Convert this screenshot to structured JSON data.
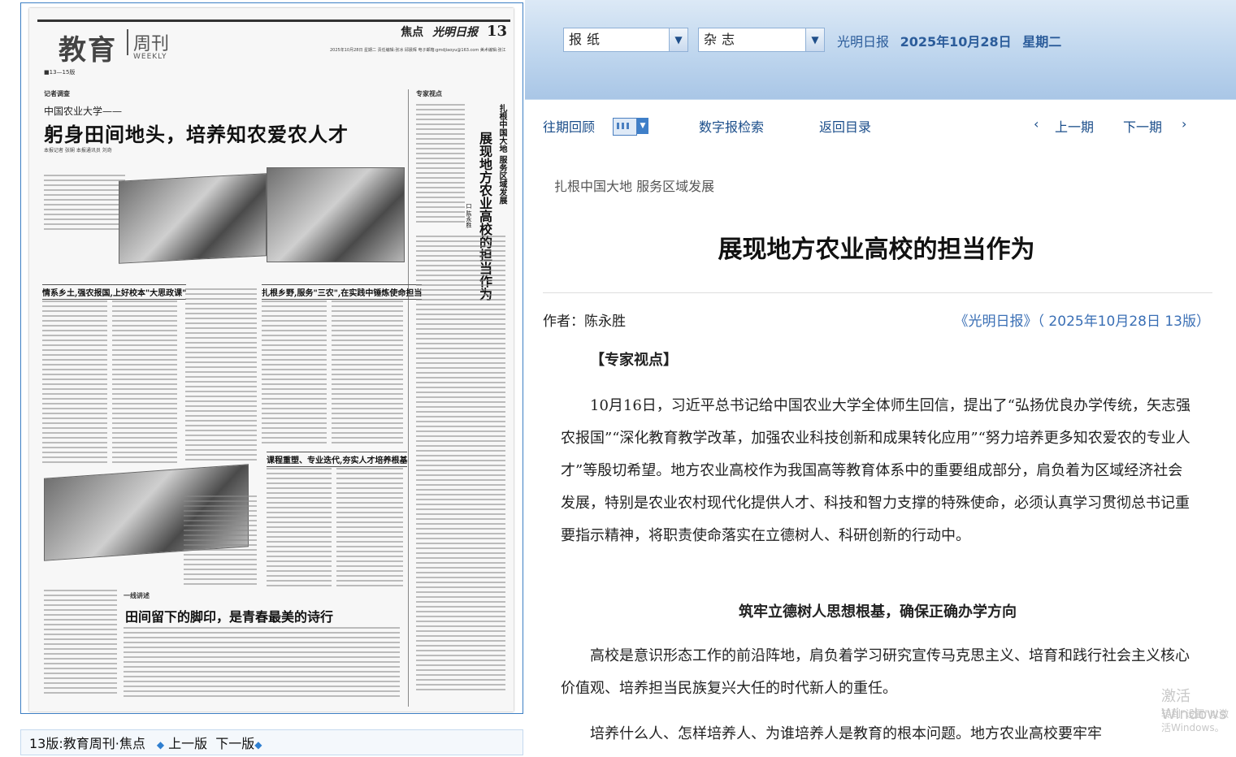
{
  "header": {
    "select_paper": "报纸",
    "select_magazine": "杂志",
    "paper_name": "光明日报",
    "date": "2025年10月28日",
    "weekday": "星期二"
  },
  "nav": {
    "archive": "往期回顾",
    "search": "数字报检索",
    "back": "返回目录",
    "prev_issue": "上一期",
    "next_issue": "下一期",
    "prev_symbol": "‹",
    "next_symbol": "›"
  },
  "paper": {
    "brand": "教育",
    "brand_sub": "周刊",
    "brand_en": "WEEKLY",
    "section": "焦点",
    "paper_logo": "光明日报",
    "page_num": "13",
    "meta": "2025年10月28日 星期二 责任编辑:张冰 邱晨辉 电子邮箱:gmdjiaoyu@163.com 美术编辑:张江",
    "page_range": "■13—15版",
    "tag_reporter": "记者调查",
    "tag_expert": "专家视点",
    "tag_first": "一线讲述",
    "kicker": "中国农业大学——",
    "main_headline": "躬身田间地头，培养知农爱农人才",
    "byline": "本报记者 张娴 本报通讯员 刘奇",
    "sub1": "情系乡土,强农报国,上好校本\"大思政课\"",
    "sub2": "扎根乡野,服务\"三农\",在实践中锤炼使命担当",
    "sub3": "课程重塑、专业迭代,夯实人才培养根基",
    "vert_small": "扎根中国大地 服务区域发展",
    "vert_big": "展现地方农业高校的担当作为",
    "vert_author": "口 陈永胜",
    "bottom_headline": "田间留下的脚印，是青春最美的诗行"
  },
  "page_bar": {
    "label": "13版:教育周刊·焦点",
    "prev": "上一版",
    "next": "下一版"
  },
  "article": {
    "kicker": "扎根中国大地 服务区域发展",
    "title": "展现地方农业高校的担当作为",
    "author": "作者：陈永胜",
    "source": "《光明日报》（ 2025年10月28日 13版）",
    "tag": "【专家视点】",
    "p1": "10月16日，习近平总书记给中国农业大学全体师生回信，提出了“弘扬优良办学传统，矢志强农报国”“深化教育教学改革，加强农业科技创新和成果转化应用”“努力培养更多知农爱农的专业人才”等殷切希望。地方农业高校作为我国高等教育体系中的重要组成部分，肩负着为区域经济社会发展，特别是农业农村现代化提供人才、科技和智力支撑的特殊使命，必须认真学习贯彻总书记重要指示精神，将职责使命落实在立德树人、科研创新的行动中。",
    "subtitle1": "筑牢立德树人思想根基，确保正确办学方向",
    "p2": "高校是意识形态工作的前沿阵地，肩负着学习研究宣传马克思主义、培育和践行社会主义核心价值观、培养担当民族复兴大任的时代新人的重任。",
    "p3": "培养什么人、怎样培养人、为谁培养人是教育的根本问题。地方农业高校要牢牢"
  },
  "watermark": {
    "line1": "激活 Windows",
    "line2": "转到\"设置\"以激活Windows。"
  }
}
